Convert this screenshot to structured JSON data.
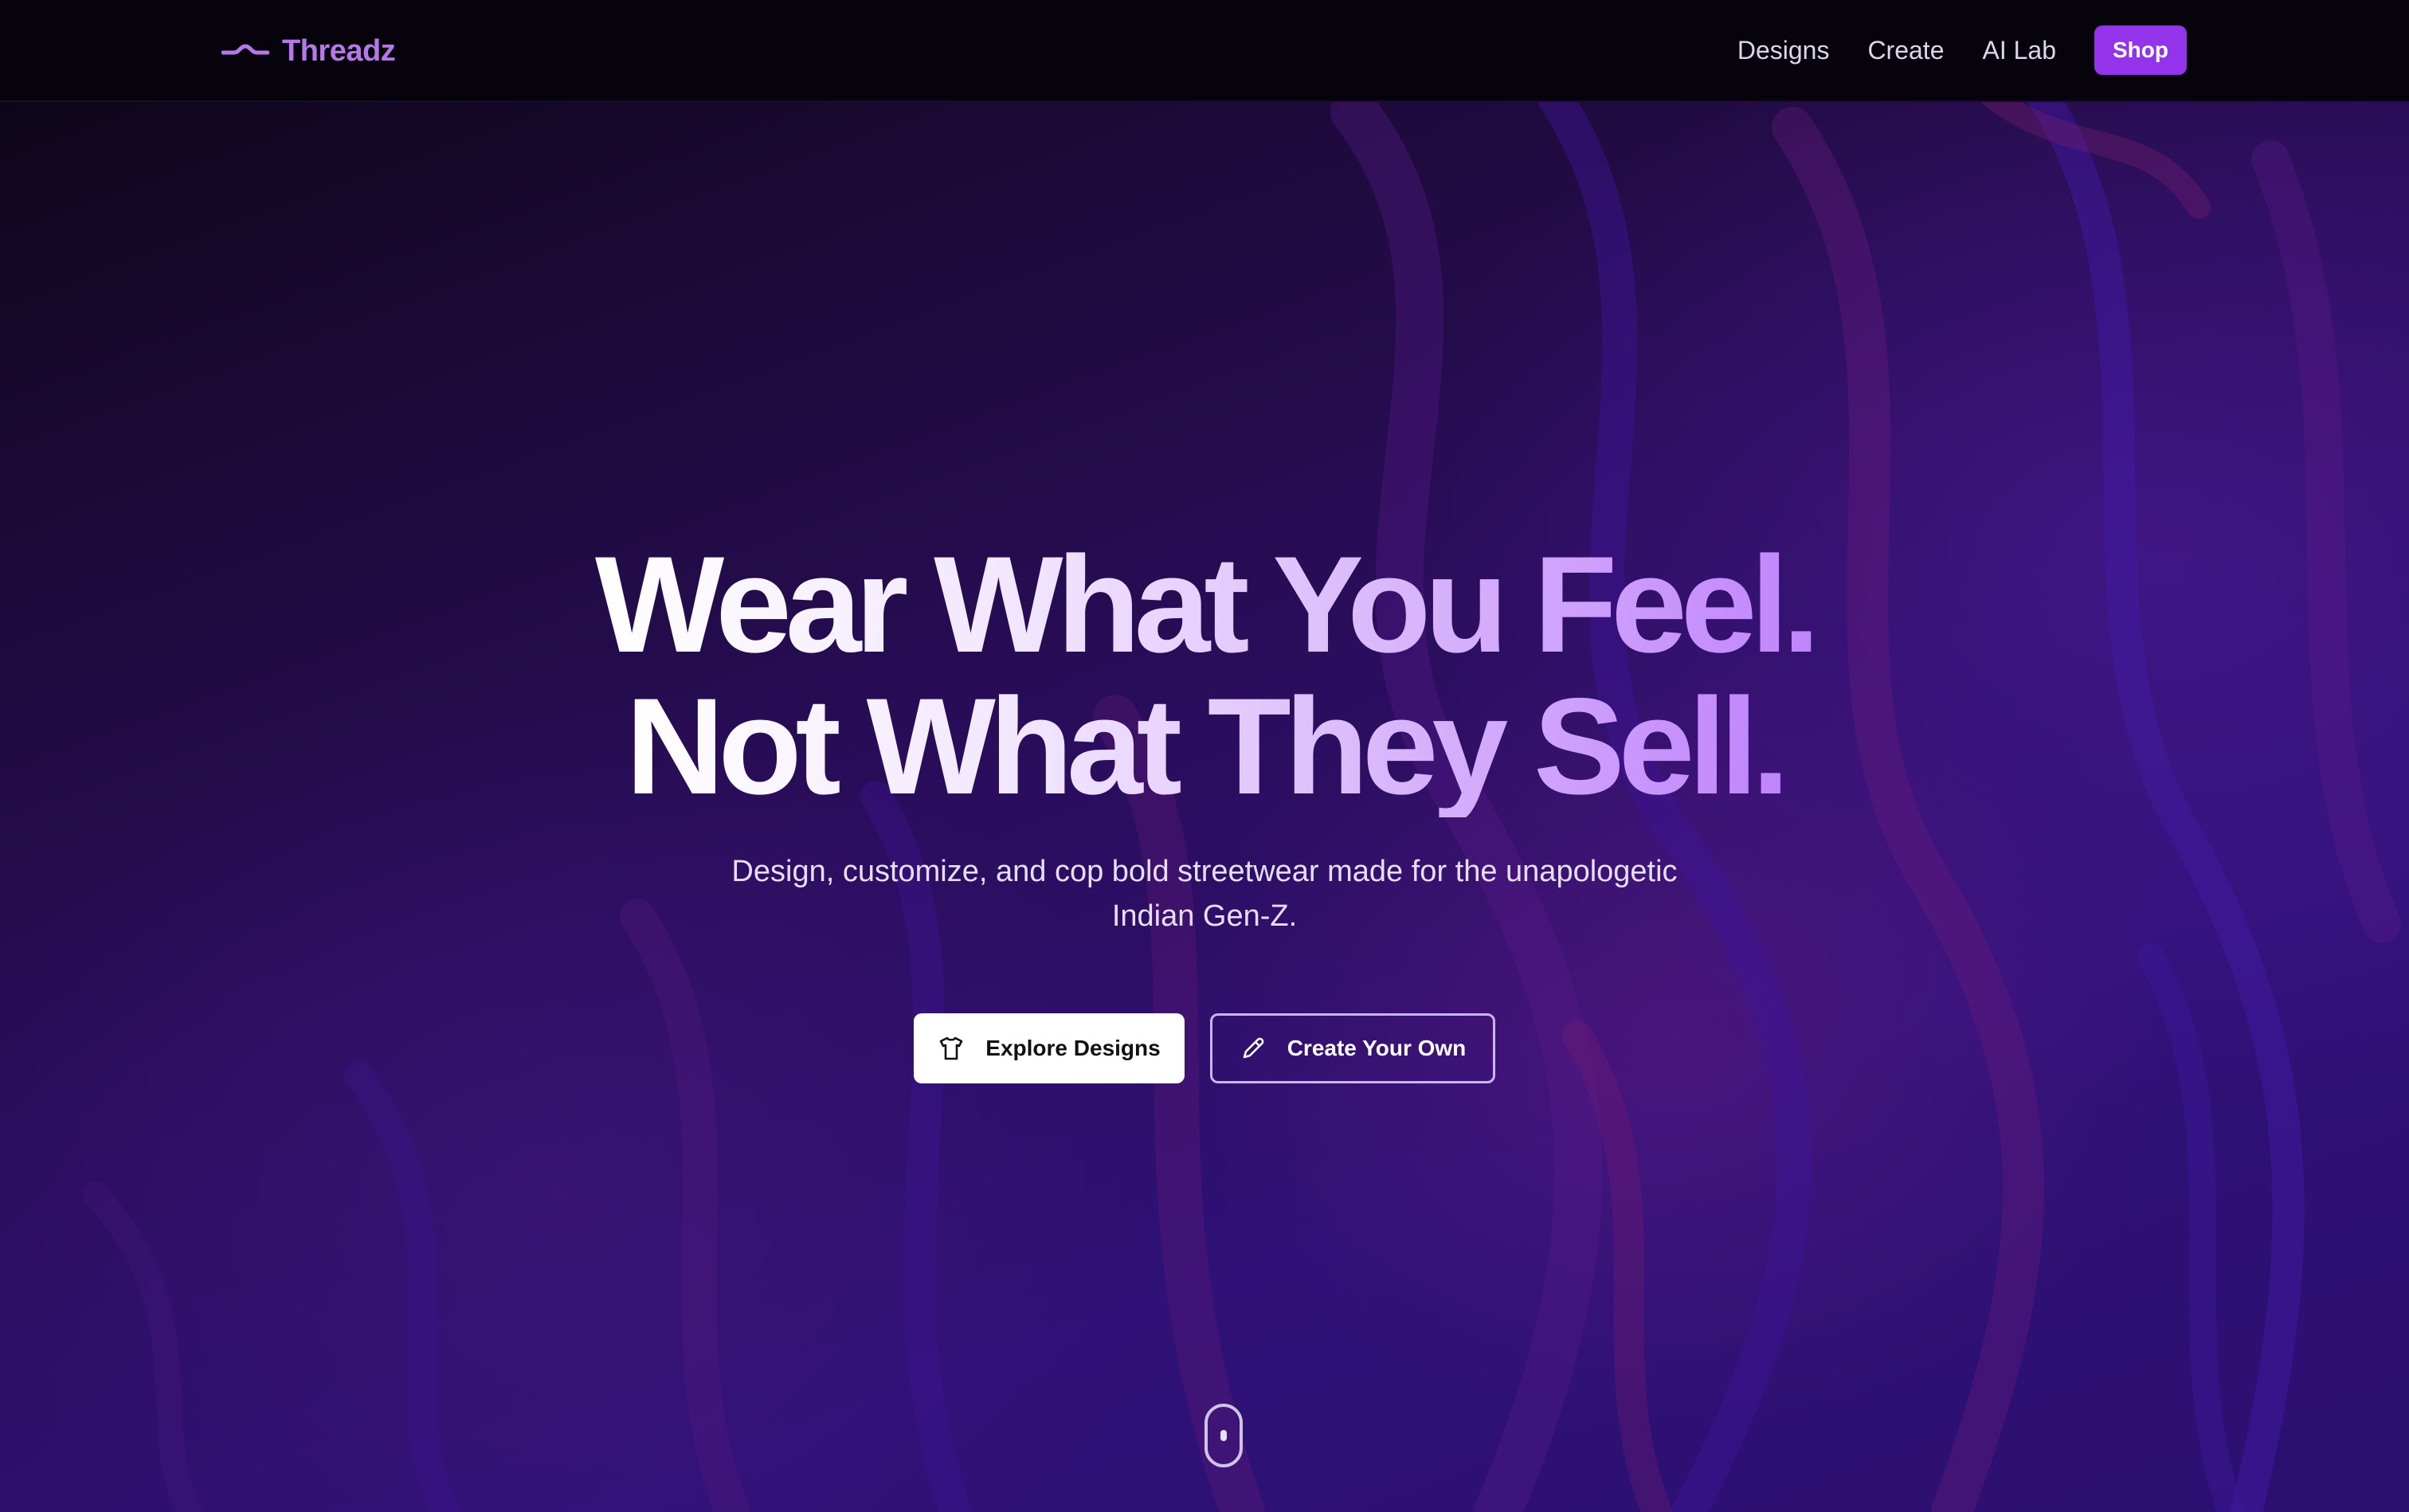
{
  "header": {
    "brand": {
      "name": "Threadz",
      "icon": "wave-logo-icon"
    },
    "nav": [
      {
        "label": "Designs"
      },
      {
        "label": "Create"
      },
      {
        "label": "AI Lab"
      }
    ],
    "shop_label": "Shop"
  },
  "hero": {
    "headline_line1": "Wear What You Feel.",
    "headline_line2": "Not What They Sell.",
    "subtitle": "Design, customize, and cop bold streetwear made for the unapologetic Indian Gen-Z.",
    "buttons": {
      "explore": {
        "label": "Explore Designs",
        "icon": "t-shirt-icon"
      },
      "create": {
        "label": "Create Your Own",
        "icon": "pencil-icon"
      }
    },
    "scroll_icon": "mouse-scroll-icon"
  },
  "colors": {
    "accent": "#9333ea",
    "brand_text": "#b478e8",
    "header_bg": "#06030c",
    "hero_gradient_end": "#c084fc"
  }
}
